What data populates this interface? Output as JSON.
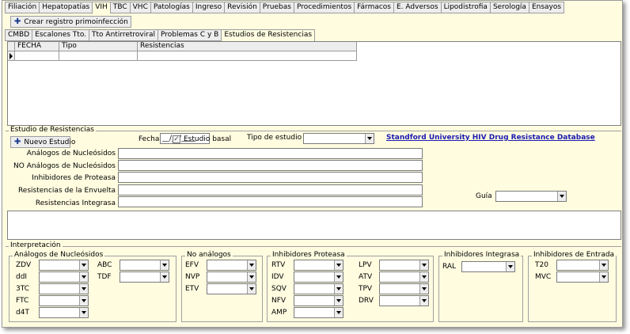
{
  "main_tabs": [
    "Filiación",
    "Hepatopatías",
    "VIH",
    "TBC",
    "VHC",
    "Patologías",
    "Ingreso",
    "Revisión",
    "Pruebas",
    "Procedimientos",
    "Fármacos",
    "E. Adversos",
    "Lipodistrofia",
    "Serología",
    "Ensayos"
  ],
  "main_tab_active": "VIH",
  "crear_registro_label": "Crear registro primoinfección",
  "sub_tabs": [
    "CMBD",
    "Escalones Tto.",
    "Tto Antirretroviral",
    "Problemas C y B",
    "Estudios de Resistencias"
  ],
  "sub_tab_active": "Estudios de Resistencias",
  "grid_columns": [
    "FECHA",
    "Tipo",
    "Resistencias"
  ],
  "estudio": {
    "group_title": "Estudio de Resistencias",
    "nuevo_label": "Nuevo Estudio",
    "fecha_label": "Fecha",
    "fecha_value": "__/__/____",
    "basal_label": "Estudio basal",
    "basal_checked": "✓",
    "tipo_label": "Tipo de estudio",
    "link": "Standford University HIV Drug Resistance Database",
    "analogos_label": "Análogos de Nucleósidos",
    "no_analogos_label": "NO Análogos de Nucleósidos",
    "proteasa_label": "Inhibidores de Proteasa",
    "envuelta_label": "Resistencias de la Envuelta",
    "integrasa_label": "Resistencias Integrasa",
    "guia_label": "Guía"
  },
  "interp": {
    "title": "Interpretación",
    "nucleosidos": {
      "title": "Análogos de Nucleósidos",
      "col1": [
        "ZDV",
        "ddI",
        "3TC",
        "FTC",
        "d4T"
      ],
      "col2": [
        "ABC",
        "TDF"
      ]
    },
    "no_analogos": {
      "title": "No análogos",
      "items": [
        "EFV",
        "NVP",
        "ETV"
      ]
    },
    "proteasa": {
      "title": "Inhibidores Proteasa",
      "col1": [
        "RTV",
        "IDV",
        "SQV",
        "NFV",
        "AMP"
      ],
      "col2": [
        "LPV",
        "ATV",
        "TPV",
        "DRV"
      ]
    },
    "integrasa": {
      "title": "Inhibidores Integrasa",
      "items": [
        "RAL"
      ]
    },
    "entrada": {
      "title": "Inhibidores de Entrada",
      "items": [
        "T20",
        "MVC"
      ]
    }
  }
}
